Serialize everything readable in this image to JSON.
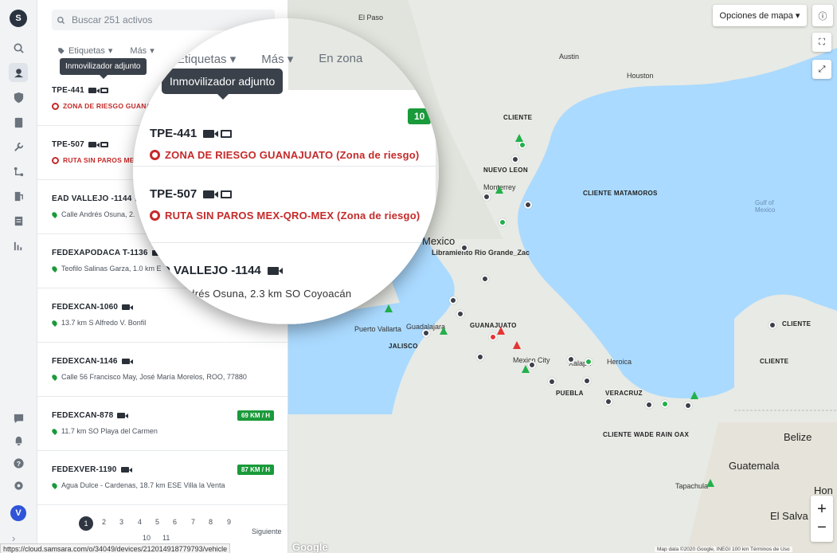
{
  "search": {
    "placeholder": "Buscar 251 activos"
  },
  "filters": {
    "tags": "Etiquetas",
    "more": "Más",
    "zone": "En zona"
  },
  "tooltip": "Inmovilizador adjunto",
  "vehicles": [
    {
      "name": "TPE-441",
      "location": "ZONA DE RIESGO GUANAJUATO",
      "location_full": "ZONA DE RIESGO GUANAJUATO (Zona de riesgo)",
      "risk": true,
      "speed": "10"
    },
    {
      "name": "TPE-507",
      "location": "RUTA SIN PAROS ME",
      "location_full": "RUTA SIN PAROS MEX-QRO-MEX (Zona de riesgo)",
      "risk": true,
      "speed": ""
    },
    {
      "name": "EAD VALLEJO -1144",
      "name_lens": "D VALLEJO -1144",
      "location": "Calle Andrés Osuna, 2.",
      "location_full": "Andrés Osuna, 2.3 km SO Coyoacán",
      "risk": false,
      "speed": ""
    },
    {
      "name": "FEDEXAPODACA T-1136",
      "location": "Teofilo Salinas Garza, 1.0 km E",
      "risk": false,
      "speed": ""
    },
    {
      "name": "FEDEXCAN-1060",
      "location": "13.7 km S Alfredo V. Bonfil",
      "risk": false,
      "speed": ""
    },
    {
      "name": "FEDEXCAN-1146",
      "location": "Calle 56 Francisco May, José María Morelos, ROO, 77880",
      "risk": false,
      "speed": ""
    },
    {
      "name": "FEDEXCAN-878",
      "location": "11.7 km SO Playa del Carmen",
      "risk": false,
      "speed": "69 KM / H"
    },
    {
      "name": "FEDEXVER-1190",
      "location": "Agua Dulce - Cardenas, 18.7 km ESE Villa la Venta",
      "risk": false,
      "speed": "87 KM / H"
    }
  ],
  "pagination": {
    "pages": [
      "1",
      "2",
      "3",
      "4",
      "5",
      "6",
      "7",
      "8",
      "9",
      "10",
      "11"
    ],
    "current": "1",
    "next": "Siguiente"
  },
  "status_url": "https://cloud.samsara.com/o/34049/devices/212014918779793/vehicle",
  "avatar_initial": "V",
  "map": {
    "options_button": "Opciones de mapa",
    "labels": {
      "el_paso": "El Paso",
      "austin": "Austin",
      "houston": "Houston",
      "cliente1": "CLIENTE",
      "nuevo_leon": "NUEVO LEON",
      "monterrey": "Monterrey",
      "cliente_matamoros": "CLIENTE MATAMOROS",
      "gulf": "Gulf of\nMexico",
      "mexico": "Mexico",
      "libramiento": "Libramiento Rio Grande_Zac",
      "guadalajara": "Guadalajara",
      "jalisco": "JALISCO",
      "puerto_vallarta": "Puerto Vallarta",
      "guanajuato": "GUANAJUATO",
      "mexico_city": "Mexico City",
      "puebla": "PUEBLA",
      "veracruz": "VERACRUZ",
      "heroica": "Heroica",
      "xalapa": "Xalapa",
      "cliente_wade": "CLIENTE WADE RAIN OAX",
      "cliente_r": "CLIENTE",
      "cliente_r2": "CLIENTE",
      "belize": "Belize",
      "guatemala": "Guatemala",
      "el_salvador": "El Salva",
      "tapachula": "Tapachula",
      "honduras": "Hon"
    },
    "attribution": "Map data ©2020 Google, INEGI   100 km   Términos de Uso",
    "google": "Google"
  },
  "colors": {
    "accent_green": "#1a9a3a",
    "risk_red": "#c52a2a",
    "dark": "#2a3038"
  }
}
